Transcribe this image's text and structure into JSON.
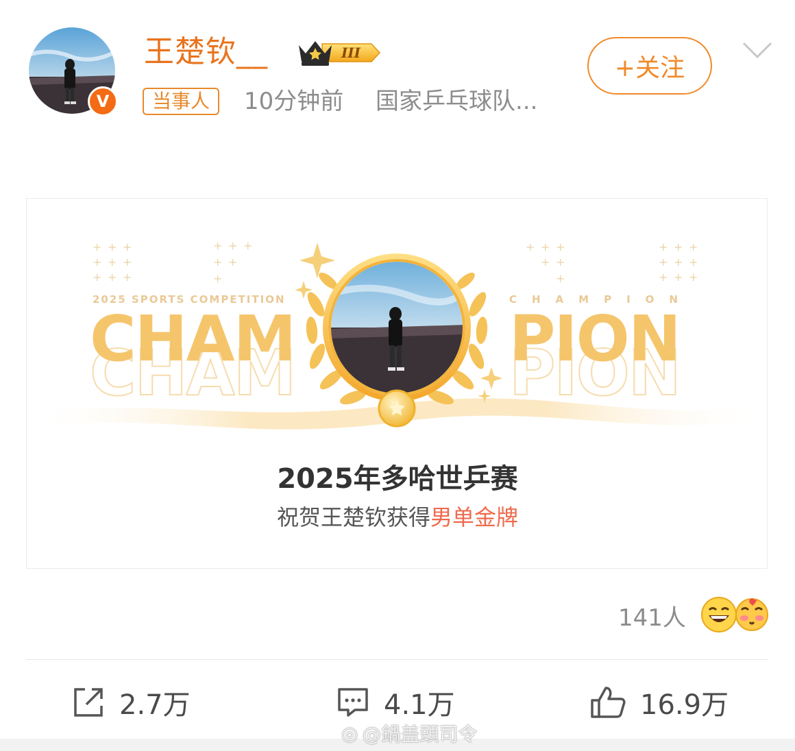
{
  "post": {
    "username": "王楚钦__",
    "level_badge": "III",
    "verified_mark": "V",
    "tag": "当事人",
    "time": "10分钟前",
    "source": "国家乒乓球队...",
    "follow_label": "+关注"
  },
  "card": {
    "sports_label": "2025 SPORTS COMPETITION",
    "champion_small": "CHAMPION",
    "champ_left": "CHAM",
    "champ_right": "PION",
    "event_title": "2025年多哈世乒赛",
    "congrats_prefix": "祝贺王楚钦获得",
    "congrats_highlight": "男单金牌"
  },
  "reactions": {
    "count": "141人",
    "emojis": [
      "laughing-emoji-icon",
      "kissing-emoji-icon"
    ]
  },
  "actions": {
    "repost": "2.7万",
    "comment": "4.1万",
    "like": "16.9万"
  },
  "watermark": "@鍋盖頭司令",
  "colors": {
    "accent_orange": "#f08a2a",
    "gold": "#f5c56c",
    "highlight_red": "#ee6a4c",
    "gray_text": "#8c8c8c"
  }
}
